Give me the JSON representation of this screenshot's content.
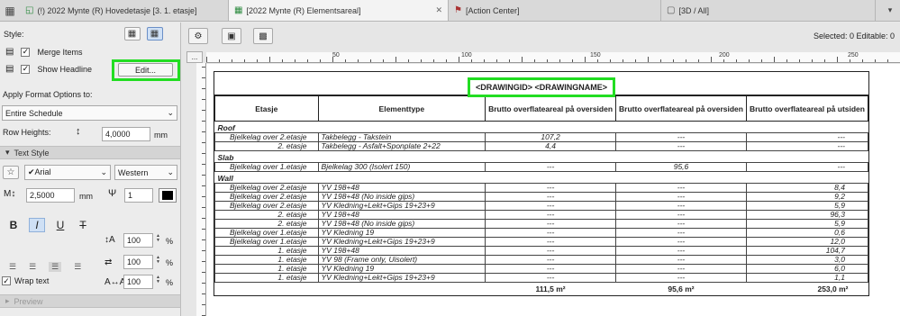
{
  "tabs": [
    {
      "label": "(!) 2022 Mynte (R) Hovedetasje [3. 1. etasje]",
      "icon": "floor-plan-icon",
      "active": false
    },
    {
      "label": "[2022 Mynte (R) Elementsareal]",
      "icon": "schedule-icon",
      "active": true
    },
    {
      "label": "[Action Center]",
      "icon": "action-center-icon",
      "active": false
    },
    {
      "label": "[3D / All]",
      "icon": "3d-icon",
      "active": false
    }
  ],
  "panel": {
    "style_label": "Style:",
    "merge_items_label": "Merge Items",
    "merge_items_checked": true,
    "show_headline_label": "Show Headline",
    "show_headline_checked": true,
    "edit_button": "Edit...",
    "apply_format_label": "Apply Format Options to:",
    "apply_format_value": "Entire Schedule",
    "row_heights_label": "Row Heights:",
    "row_heights_value": "4,0000",
    "row_heights_unit": "mm",
    "text_style_label": "Text Style",
    "font_value": "✔Arial",
    "charset_value": "Western",
    "font_size_value": "2,5000",
    "font_size_unit": "mm",
    "pen_value": "1",
    "indent1_value": "100",
    "indent2_value": "100",
    "indent3_value": "100",
    "percent": "%",
    "wrap_text_label": "Wrap text",
    "wrap_text_checked": true,
    "preview_label": "Preview"
  },
  "toolbar": {
    "selected_text": "Selected: 0  Editable: 0"
  },
  "ruler": {
    "labels": [
      "50",
      "100",
      "150",
      "200",
      "250"
    ],
    "corner": "..."
  },
  "schedule": {
    "title": "<DRAWINGID> <DRAWINGNAME>",
    "headers": [
      "Etasje",
      "Elementtype",
      "Brutto overflateareal på oversiden",
      "Brutto overflateareal på oversiden",
      "Brutto overflateareal på utsiden"
    ],
    "groups": [
      {
        "name": "Roof",
        "rows": [
          [
            "Bjelkelag over 2.etasje",
            "Takbelegg - Takstein",
            "107,2",
            "---",
            "---"
          ],
          [
            "2. etasje",
            "Takbelegg - Asfalt+Sponplate  2+22",
            "4,4",
            "---",
            "---"
          ]
        ]
      },
      {
        "name": "Slab",
        "rows": [
          [
            "Bjelkelag over 1.etasje",
            "Bjelkelag  300 (Isolert 150)",
            "---",
            "95,6",
            "---"
          ]
        ]
      },
      {
        "name": "Wall",
        "rows": [
          [
            "Bjelkelag over 2.etasje",
            "YV   198+48",
            "---",
            "---",
            "8,4"
          ],
          [
            "Bjelkelag over 2.etasje",
            "YV   198+48 (No inside gips)",
            "---",
            "---",
            "9,2"
          ],
          [
            "Bjelkelag over 2.etasje",
            "YV   Kledning+Lekt+Gips  19+23+9",
            "---",
            "---",
            "5,9"
          ],
          [
            "2. etasje",
            "YV   198+48",
            "---",
            "---",
            "96,3"
          ],
          [
            "2. etasje",
            "YV   198+48 (No inside gips)",
            "---",
            "---",
            "5,9"
          ],
          [
            "Bjelkelag over 1.etasje",
            "YV   Kledning  19",
            "---",
            "---",
            "0,6"
          ],
          [
            "Bjelkelag over 1.etasje",
            "YV   Kledning+Lekt+Gips  19+23+9",
            "---",
            "---",
            "12,0"
          ],
          [
            "1. etasje",
            "YV   198+48",
            "---",
            "---",
            "104,7"
          ],
          [
            "1. etasje",
            "YV   98 (Frame only, Uisolert)",
            "---",
            "---",
            "3,0"
          ],
          [
            "1. etasje",
            "YV   Kledning  19",
            "---",
            "---",
            "6,0"
          ],
          [
            "1. etasje",
            "YV   Kledning+Lekt+Gips  19+23+9",
            "---",
            "---",
            "1,1"
          ]
        ]
      }
    ],
    "totals": [
      "",
      "",
      "111,5 m²",
      "95,6 m²",
      "253,0 m²"
    ]
  },
  "colors": {
    "highlight": "#22dd22",
    "active_tab": "#f3f3f3"
  }
}
